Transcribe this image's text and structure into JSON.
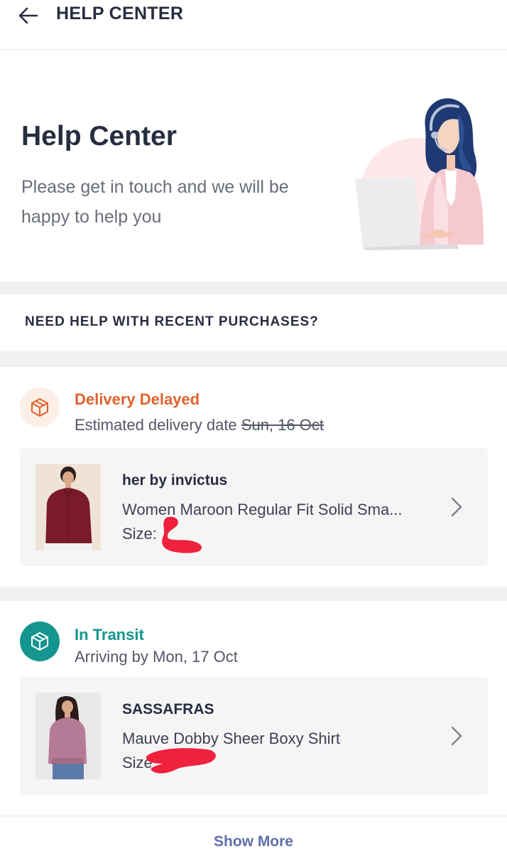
{
  "header": {
    "title": "HELP CENTER",
    "back_icon": "arrow-left-icon"
  },
  "hero": {
    "title": "Help Center",
    "subtitle": "Please get in touch and we will be happy to help you",
    "illustration": "support-agent-illustration"
  },
  "recent_purchases": {
    "heading": "NEED HELP WITH RECENT PURCHASES?"
  },
  "orders": [
    {
      "status": "Delivery Delayed",
      "status_color": "#e0622d",
      "status_icon_bg": "#fdeee6",
      "status_icon": "package-icon",
      "desc_prefix": "Estimated delivery date ",
      "desc_struck": "Sun, 16 Oct",
      "brand": "her by invictus",
      "product_name": "Women Maroon Regular Fit Solid Sma...",
      "size_label": "Size:"
    },
    {
      "status": "In Transit",
      "status_color": "#14958f",
      "status_icon_bg": "#14958f",
      "status_icon": "package-icon",
      "desc": "Arriving by Mon, 17 Oct",
      "brand": "SASSAFRAS",
      "product_name": "Mauve Dobby Sheer Boxy Shirt",
      "size_label": "Size"
    }
  ],
  "footer": {
    "show_more": "Show More"
  },
  "colors": {
    "accent_link": "#5f6fa8",
    "text_primary": "#282c3f",
    "separator": "#f1f1f3",
    "redaction": "#f0213d"
  }
}
